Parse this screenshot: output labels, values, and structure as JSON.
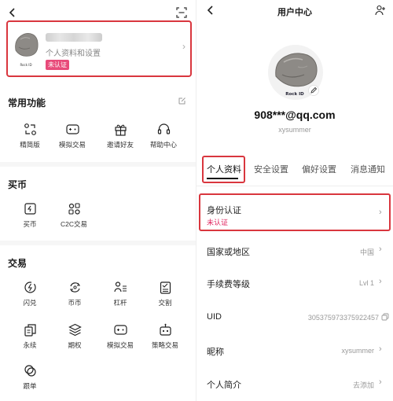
{
  "left": {
    "profile": {
      "subtitle": "个人资料和设置",
      "status_badge": "未认证",
      "avatar_caption": "Rock ID"
    },
    "common": {
      "title": "常用功能",
      "items": [
        "精简版",
        "模拟交易",
        "邀请好友",
        "帮助中心"
      ]
    },
    "buy": {
      "title": "买币",
      "items": [
        "买币",
        "C2C交易"
      ]
    },
    "trade": {
      "title": "交易",
      "items": [
        "闪兑",
        "币币",
        "杠杆",
        "交割",
        "永续",
        "期权",
        "模拟交易",
        "策略交易",
        "跟单"
      ]
    }
  },
  "right": {
    "header": {
      "title": "用户中心"
    },
    "account": {
      "email": "908***@qq.com",
      "username": "xysummer",
      "avatar_caption": "Rock ID"
    },
    "tabs": [
      "个人资料",
      "安全设置",
      "偏好设置",
      "消息通知"
    ],
    "identity": {
      "label": "身份认证",
      "status": "未认证"
    },
    "rows": [
      {
        "label": "国家或地区",
        "value": "中国"
      },
      {
        "label": "手续费等级",
        "value": "Lvl 1"
      },
      {
        "label": "UID",
        "value": "305375973375922457"
      },
      {
        "label": "昵称",
        "value": "xysummer"
      },
      {
        "label": "个人简介",
        "value": "去添加"
      }
    ]
  },
  "colors": {
    "highlight_border": "#d9363e",
    "badge_bg": "#e84b7a",
    "status_red": "#e0245e"
  },
  "icons": {
    "back": "chevron-left-icon",
    "scan": "scan-icon",
    "add_user": "add-user-icon",
    "edit": "edit-icon"
  }
}
